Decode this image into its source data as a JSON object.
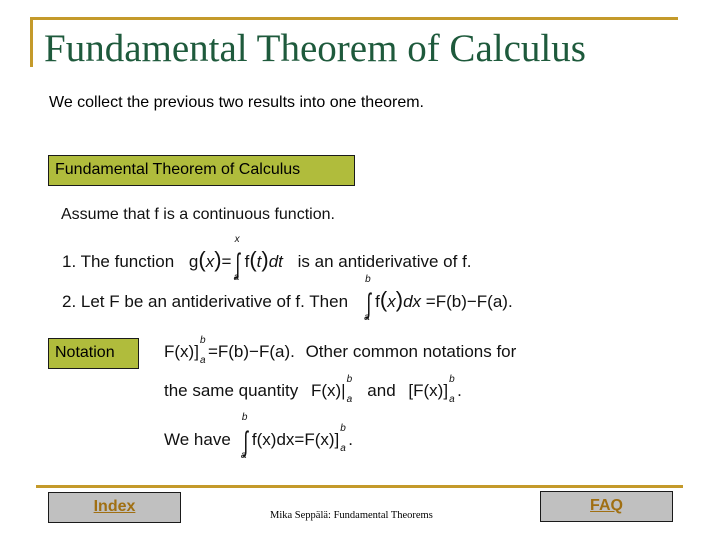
{
  "slide": {
    "title": "Fundamental Theorem of Calculus",
    "intro": "We collect the previous two results into one theorem.",
    "theorem_box_label": "Fundamental Theorem of Calculus",
    "assumption": "Assume that  f  is a continuous function.",
    "item1": {
      "prefix": "1.  The function",
      "formula": {
        "g": "g",
        "x": "x",
        "eq": "=",
        "upper": "x",
        "lower": "a",
        "f": "f",
        "t": "t",
        "dt": "dt"
      },
      "suffix": "is an antiderivative of  f."
    },
    "item2": {
      "prefix": "2. Let  F  be an antiderivative of  f.   Then",
      "formula": {
        "upper": "b",
        "lower": "a",
        "lhs": "f",
        "x": "x",
        "dx": "dx",
        "eq": "=",
        "rhs": "F(b)−F(a)."
      }
    },
    "notation_box_label": "Notation",
    "notation": {
      "line1_formula": "F(x)]",
      "line1_upper": "b",
      "line1_lower": "a",
      "line1_rhs": "=F(b)−F(a).",
      "line1_text": "Other common notations for",
      "line2_prefix": "the same quantity",
      "line2_alt1": "F(x)|",
      "line2_and": "and",
      "line2_alt2": "[F(x)]",
      "line2_upper": "b",
      "line2_lower": "a",
      "line3_prefix": "We have",
      "line3_upper": "b",
      "line3_lower": "a",
      "line3_integrand": "f(x)dx",
      "line3_rhs": "=F(x)]",
      "line3_end": "."
    }
  },
  "footer": {
    "index_label": "Index",
    "faq_label": "FAQ",
    "caption": "Mika Seppälä: Fundamental Theorems"
  },
  "colors": {
    "gold": "#c49a2a",
    "title_green": "#1e5a3c",
    "box_green": "#b0bc3c",
    "button_gray": "#c0c0c0",
    "link_brown": "#a06f12"
  }
}
